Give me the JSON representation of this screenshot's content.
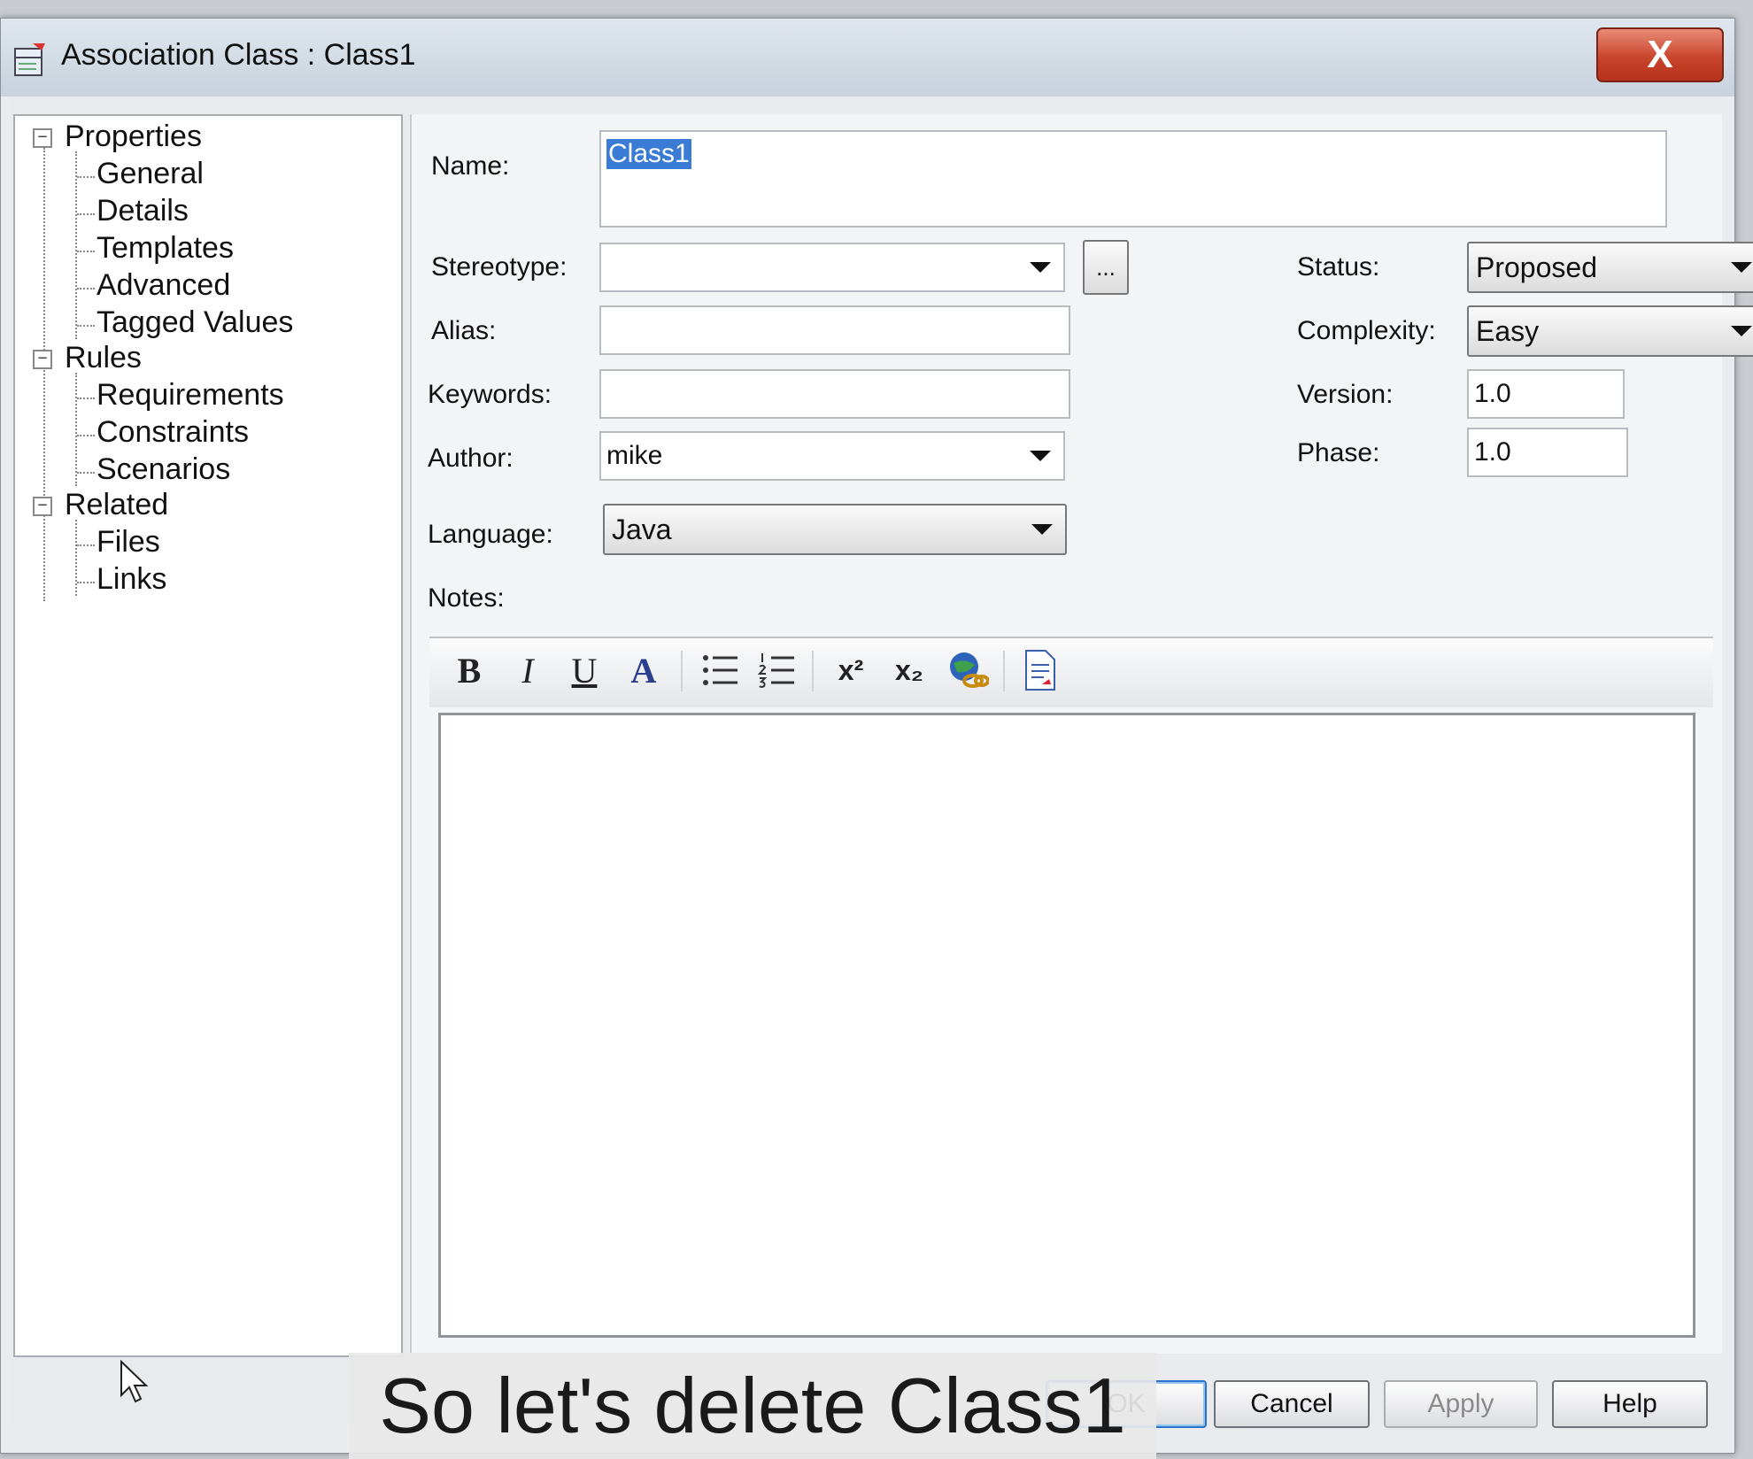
{
  "window": {
    "title": "Association Class : Class1",
    "close_label": "X"
  },
  "tree": {
    "groups": [
      {
        "label": "Properties",
        "expander": "−",
        "children": [
          "General",
          "Details",
          "Templates",
          "Advanced",
          "Tagged Values"
        ]
      },
      {
        "label": "Rules",
        "expander": "−",
        "children": [
          "Requirements",
          "Constraints",
          "Scenarios"
        ]
      },
      {
        "label": "Related",
        "expander": "−",
        "children": [
          "Files",
          "Links"
        ]
      }
    ]
  },
  "form": {
    "name_label": "Name:",
    "name_value": "Class1",
    "stereotype_label": "Stereotype:",
    "stereotype_value": "",
    "stereotype_more": "...",
    "alias_label": "Alias:",
    "alias_value": "",
    "keywords_label": "Keywords:",
    "keywords_value": "",
    "author_label": "Author:",
    "author_value": "mike",
    "language_label": "Language:",
    "language_value": "Java",
    "notes_label": "Notes:",
    "status_label": "Status:",
    "status_value": "Proposed",
    "complexity_label": "Complexity:",
    "complexity_value": "Easy",
    "version_label": "Version:",
    "version_value": "1.0",
    "phase_label": "Phase:",
    "phase_value": "1.0"
  },
  "toolbar": {
    "bold": "B",
    "italic": "I",
    "underline": "U",
    "font_color": "A",
    "superscript": "x²",
    "subscript": "x₂"
  },
  "footer": {
    "ok_label": "OK",
    "cancel_label": "Cancel",
    "apply_label": "Apply",
    "help_label": "Help"
  },
  "caption": "So let's delete Class1",
  "colors": {
    "selection": "#3a7bd5",
    "close_button": "#c9442c"
  }
}
